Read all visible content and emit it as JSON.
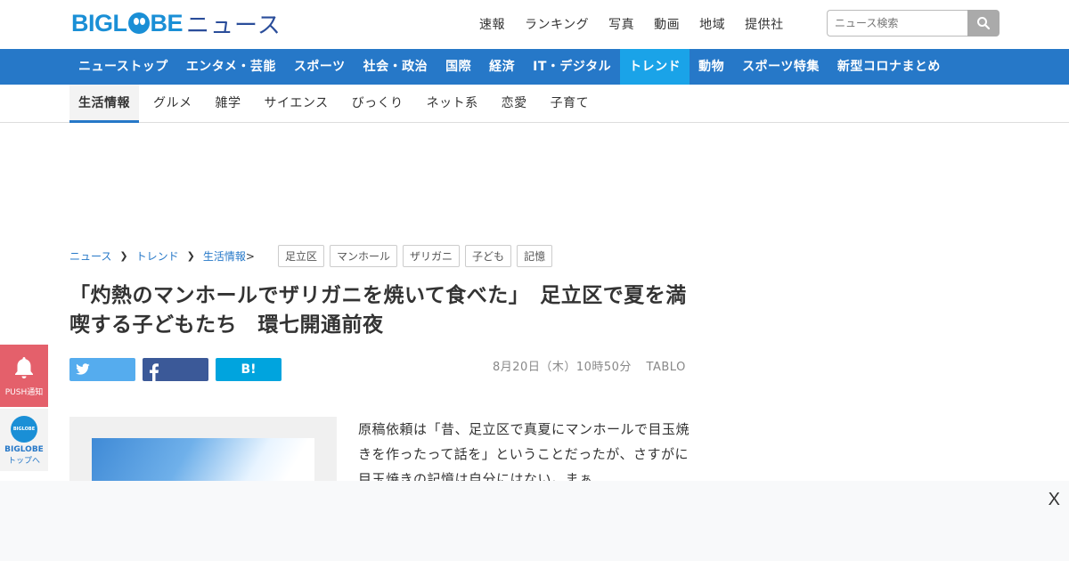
{
  "header": {
    "logo_main": "BIGLOBE",
    "logo_sub": "ニュース",
    "top_nav": [
      "速報",
      "ランキング",
      "写真",
      "動画",
      "地域",
      "提供社"
    ],
    "search_placeholder": "ニュース検索"
  },
  "main_nav": [
    {
      "label": "ニューストップ",
      "active": false
    },
    {
      "label": "エンタメ・芸能",
      "active": false
    },
    {
      "label": "スポーツ",
      "active": false
    },
    {
      "label": "社会・政治",
      "active": false
    },
    {
      "label": "国際",
      "active": false
    },
    {
      "label": "経済",
      "active": false
    },
    {
      "label": "IT・デジタル",
      "active": false
    },
    {
      "label": "トレンド",
      "active": true
    },
    {
      "label": "動物",
      "active": false
    },
    {
      "label": "スポーツ特集",
      "active": false
    },
    {
      "label": "新型コロナまとめ",
      "active": false
    }
  ],
  "sub_nav": [
    {
      "label": "生活情報",
      "active": true
    },
    {
      "label": "グルメ",
      "active": false
    },
    {
      "label": "雑学",
      "active": false
    },
    {
      "label": "サイエンス",
      "active": false
    },
    {
      "label": "びっくり",
      "active": false
    },
    {
      "label": "ネット系",
      "active": false
    },
    {
      "label": "恋愛",
      "active": false
    },
    {
      "label": "子育て",
      "active": false
    }
  ],
  "breadcrumb": {
    "items": [
      "ニュース",
      "トレンド",
      "生活情報"
    ],
    "trailing": ">"
  },
  "tags": [
    "足立区",
    "マンホール",
    "ザリガニ",
    "子ども",
    "記憶"
  ],
  "article": {
    "title": "「灼熱のマンホールでザリガニを焼いて食べた」　足立区で夏を満喫する子どもたち　環七開通前夜",
    "date": "8月20日（木）10時50分",
    "source": "TABLO",
    "body": "原稿依頼は「昔、足立区で真夏にマンホールで目玉焼きを作ったって話を」ということだったが、さすがに目玉焼きの記憶は自分にはない。まぁ"
  },
  "share": {
    "hatena_label": "B!"
  },
  "side": {
    "push_label": "PUSH通知",
    "top_icon_text": "BIGLOBE",
    "top_label_1": "BIGLOBE",
    "top_label_2": "トップへ"
  },
  "ad": {
    "close_label": "X"
  },
  "colors": {
    "nav_blue": "#2678c8",
    "active_tab": "#1aa3e8",
    "push_red": "#e4606b"
  }
}
